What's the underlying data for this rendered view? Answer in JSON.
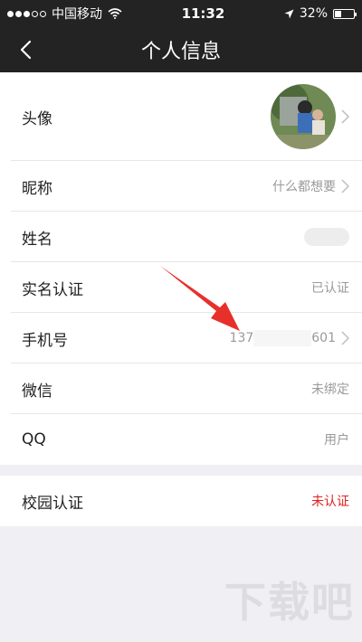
{
  "status_bar": {
    "carrier": "中国移动",
    "time": "11:32",
    "battery_percent": "32%",
    "battery_level": 0.32,
    "icons": [
      "signal-dots-icon",
      "wifi-icon",
      "location-arrow-icon",
      "battery-icon"
    ]
  },
  "nav": {
    "title": "个人信息",
    "back_icon": "chevron-left-icon"
  },
  "profile_rows": [
    {
      "label": "头像",
      "value": ""
    },
    {
      "label": "昵称",
      "value": "什么都想要"
    },
    {
      "label": "姓名",
      "value": ""
    },
    {
      "label": "实名认证",
      "value": "已认证"
    },
    {
      "label": "手机号",
      "value_prefix": "137",
      "value_suffix": "601"
    },
    {
      "label": "微信",
      "value": "未绑定"
    },
    {
      "label": "QQ",
      "value": "用户"
    }
  ],
  "campus_row": {
    "label": "校园认证",
    "value": "未认证"
  },
  "watermark": "下载吧",
  "colors": {
    "bar": "#232323",
    "accent_red": "#e02020",
    "secondary_text": "#9a9a9a",
    "page_bg": "#efeff4",
    "annotation_arrow": "#e8302a"
  }
}
